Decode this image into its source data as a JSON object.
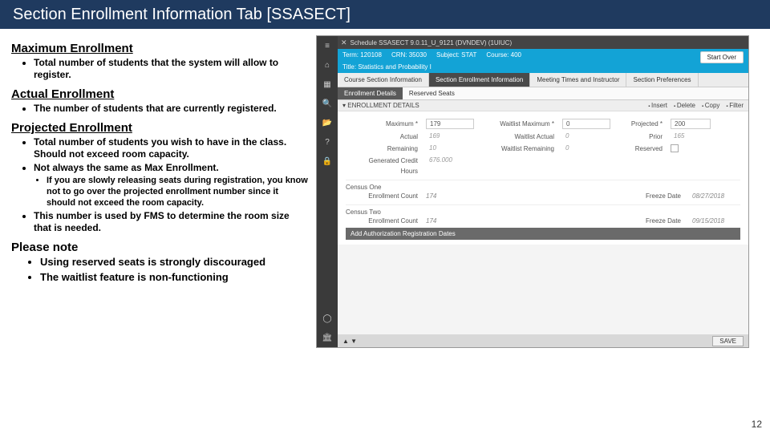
{
  "title": "Section Enrollment Information Tab  [SSASECT]",
  "left": {
    "max_h": "Maximum Enrollment",
    "max_b": "Total number of students that the system will allow to register.",
    "act_h": "Actual Enrollment",
    "act_b": "The number of students that are currently registered.",
    "proj_h": "Projected Enrollment",
    "proj_b1": "Total number of students you wish to have in the class. Should not exceed room capacity.",
    "proj_b2": "Not always the same as Max Enrollment.",
    "proj_s1": "If you are slowly releasing seats during registration, you know not to go over the projected enrollment number since it should not exceed the room capacity.",
    "proj_b3": "This number is used by FMS to determine the room size that is needed.",
    "note_h": "Please note",
    "note_b1": "Using reserved seats is strongly discouraged",
    "note_b2": "The waitlist feature is non-functioning"
  },
  "app": {
    "tab_title": "Schedule SSASECT 9.0.11_U_9121 (DVNDEV) (1UIUC)",
    "start_over": "Start Over",
    "header": {
      "term_l": "Term:",
      "term_v": "120108",
      "crn_l": "CRN:",
      "crn_v": "35030",
      "subj_l": "Subject:",
      "subj_v": "STAT",
      "course_l": "Course:",
      "course_v": "400",
      "title_l": "Title:",
      "title_v": "Statistics and Probability I"
    },
    "pgtabs": {
      "t1": "Course Section Information",
      "t2": "Section Enrollment Information",
      "t3": "Meeting Times and Instructor",
      "t4": "Section Preferences"
    },
    "subtabs": {
      "s1": "Enrollment Details",
      "s2": "Reserved Seats"
    },
    "toolbar": {
      "section": "ENROLLMENT DETAILS",
      "insert": "Insert",
      "delete": "Delete",
      "copy": "Copy",
      "filter": "Filter"
    },
    "form": {
      "max_l": "Maximum *",
      "max_v": "179",
      "wmax_l": "Waitlist Maximum *",
      "wmax_v": "0",
      "proj_l": "Projected *",
      "proj_v": "200",
      "act_l": "Actual",
      "act_v": "169",
      "wact_l": "Waitlist Actual",
      "wact_v": "0",
      "prior_l": "Prior",
      "prior_v": "165",
      "rem_l": "Remaining",
      "rem_v": "10",
      "wrem_l": "Waitlist Remaining",
      "wrem_v": "0",
      "res_l": "Reserved",
      "gc_l": "Generated Credit",
      "gc_v": "676.000",
      "hours_l": "Hours"
    },
    "census1": {
      "h": "Census One",
      "ec_l": "Enrollment Count",
      "ec_v": "174",
      "fd_l": "Freeze Date",
      "fd_v": "08/27/2018"
    },
    "census2": {
      "h": "Census Two",
      "ec_l": "Enrollment Count",
      "ec_v": "174",
      "fd_l": "Freeze Date",
      "fd_v": "09/15/2018"
    },
    "add_bar": "Add Authorization Registration Dates",
    "footer_arrows": "▲ ▼",
    "save": "SAVE"
  },
  "pagenum": "12"
}
